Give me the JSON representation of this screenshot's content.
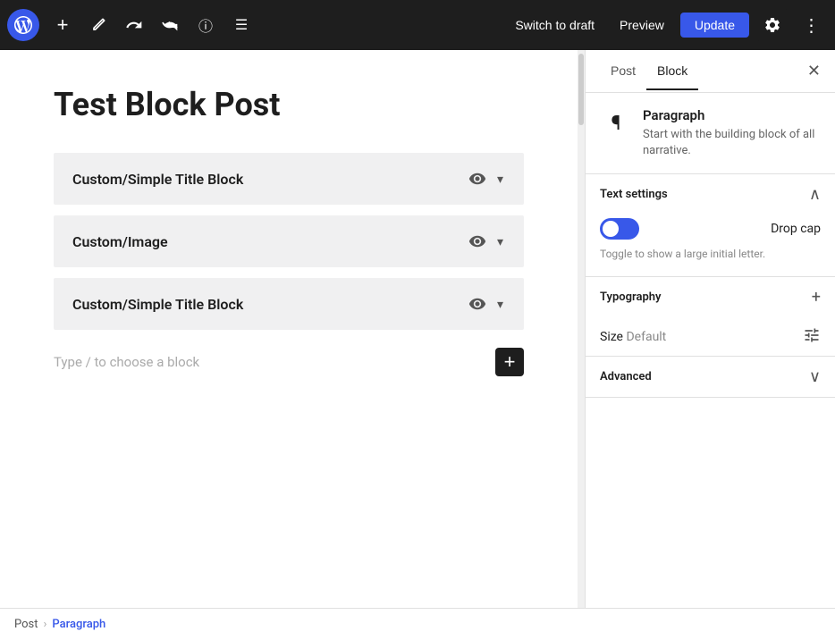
{
  "toolbar": {
    "add_label": "+",
    "switch_draft_label": "Switch to draft",
    "preview_label": "Preview",
    "update_label": "Update"
  },
  "editor": {
    "post_title": "Test Block Post",
    "blocks": [
      {
        "id": 1,
        "title": "Custom/Simple Title Block"
      },
      {
        "id": 2,
        "title": "Custom/Image"
      },
      {
        "id": 3,
        "title": "Custom/Simple Title Block"
      }
    ],
    "type_hint": "Type / to choose a block"
  },
  "sidebar": {
    "tab_post": "Post",
    "tab_block": "Block",
    "active_tab": "Block",
    "block_info": {
      "icon": "¶",
      "name": "Paragraph",
      "description": "Start with the building block of all narrative."
    },
    "text_settings": {
      "section_title": "Text settings",
      "drop_cap_label": "Drop cap",
      "drop_cap_hint": "Toggle to show a large initial letter."
    },
    "typography": {
      "section_title": "Typography",
      "size_label": "Size",
      "size_value": "Default"
    },
    "advanced": {
      "section_title": "Advanced"
    }
  },
  "breadcrumb": {
    "parent": "Post",
    "separator": "›",
    "current": "Paragraph"
  }
}
